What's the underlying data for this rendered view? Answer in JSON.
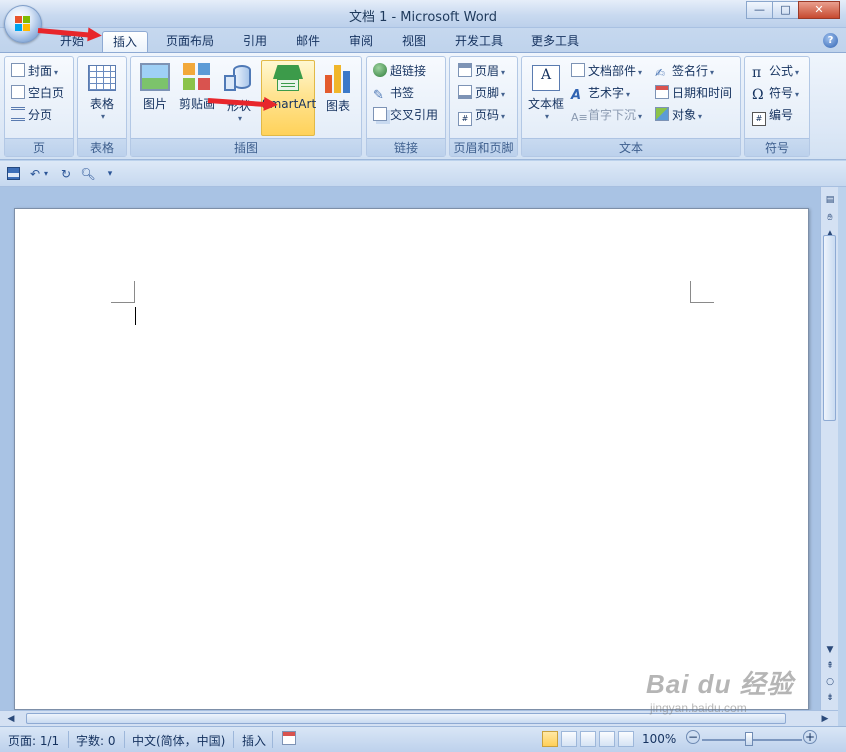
{
  "window": {
    "title": "文档 1 - Microsoft Word",
    "controls": {
      "minimize": "—",
      "maximize": "□",
      "close": "✕"
    }
  },
  "tabs": [
    {
      "label": "开始",
      "active": false
    },
    {
      "label": "插入",
      "active": true
    },
    {
      "label": "页面布局",
      "active": false
    },
    {
      "label": "引用",
      "active": false
    },
    {
      "label": "邮件",
      "active": false
    },
    {
      "label": "审阅",
      "active": false
    },
    {
      "label": "视图",
      "active": false
    },
    {
      "label": "开发工具",
      "active": false
    },
    {
      "label": "更多工具",
      "active": false
    }
  ],
  "ribbon": {
    "pages": {
      "label": "页",
      "items": [
        "封面",
        "空白页",
        "分页"
      ]
    },
    "tables": {
      "label": "表格",
      "table_button": "表格"
    },
    "illustrations": {
      "label": "插图",
      "picture": "图片",
      "clipart": "剪贴画",
      "shapes": "形状",
      "smartart": "SmartArt",
      "chart": "图表"
    },
    "links": {
      "label": "链接",
      "items": [
        "超链接",
        "书签",
        "交叉引用"
      ]
    },
    "header_footer": {
      "label": "页眉和页脚",
      "items": [
        "页眉",
        "页脚",
        "页码"
      ]
    },
    "text": {
      "label": "文本",
      "textbox": "文本框",
      "quickparts": "文档部件",
      "wordart": "艺术字",
      "dropcap": "首字下沉",
      "signature": "签名行",
      "datetime": "日期和时间",
      "object": "对象"
    },
    "symbols": {
      "label": "符号",
      "equation": "公式",
      "symbol": "符号",
      "number": "编号"
    }
  },
  "status": {
    "page": "页面: 1/1",
    "words": "字数: 0",
    "language": "中文(简体，中国)",
    "mode": "插入",
    "zoom": "100%"
  },
  "watermark": {
    "main": "Bai du 经验",
    "url": "jingyan.baidu.com"
  },
  "colors": {
    "annotation_arrow": "#e8262b",
    "ribbon_hot": "#ffd25a"
  }
}
